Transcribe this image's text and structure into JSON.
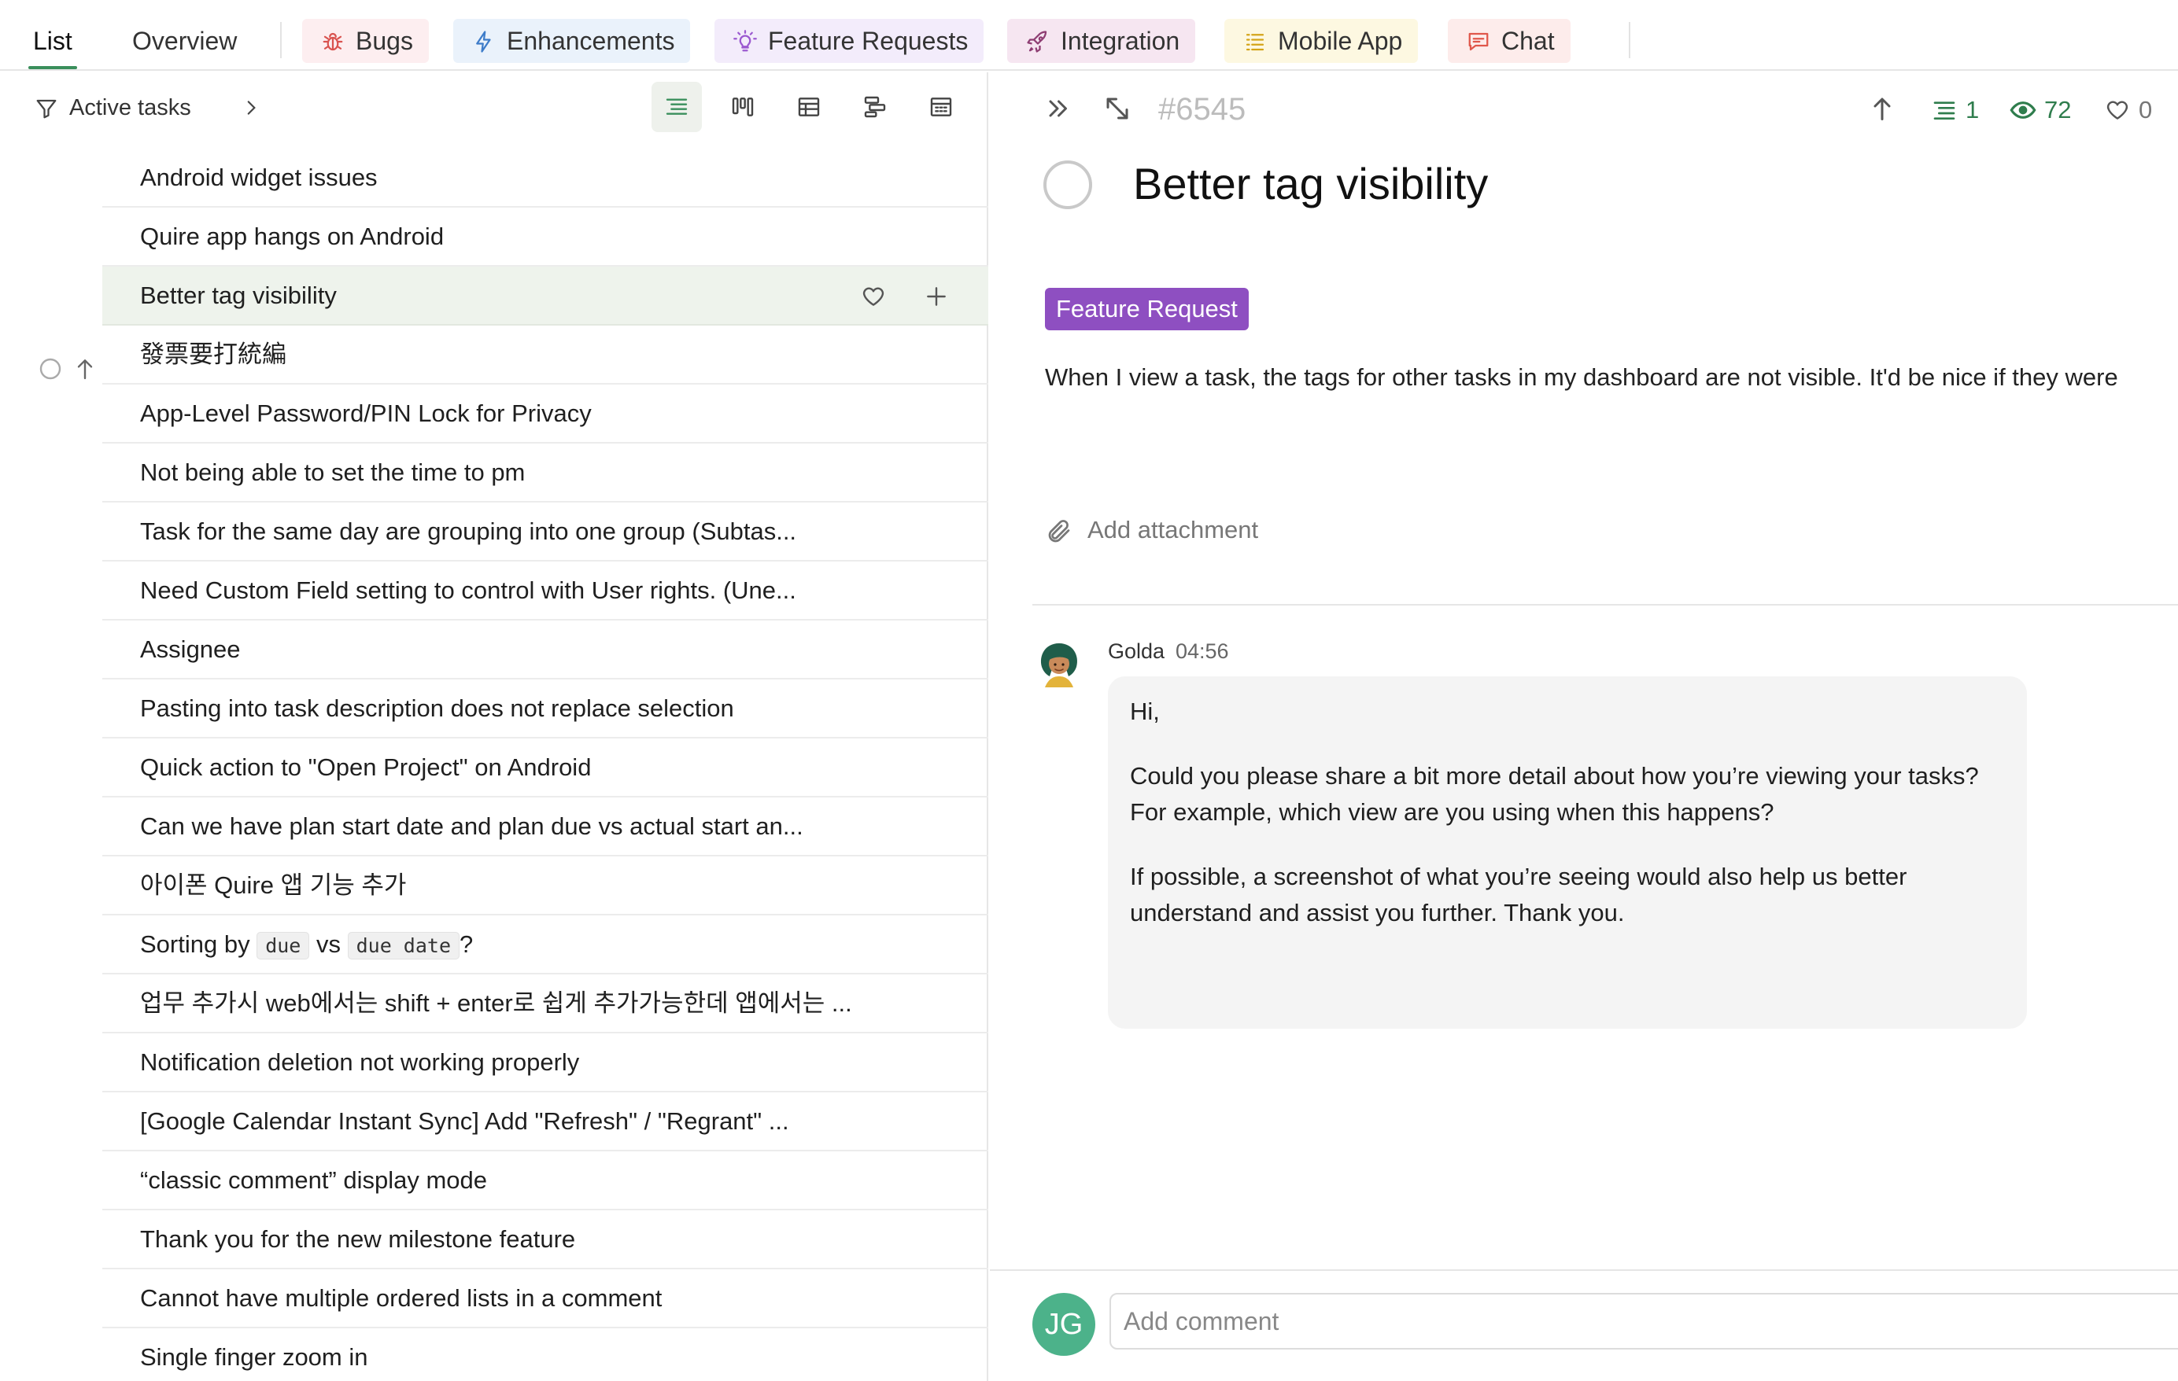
{
  "top_tabs": {
    "list": "List",
    "overview": "Overview",
    "pills": [
      {
        "label": "Bugs",
        "icon": "bug-icon",
        "bg": "#fdeef0",
        "color": "#d9534f"
      },
      {
        "label": "Enhancements",
        "icon": "lightning-icon",
        "bg": "#eaf2fb",
        "color": "#3d7cc9"
      },
      {
        "label": "Feature Requests",
        "icon": "lightbulb-icon",
        "bg": "#f3ecfb",
        "color": "#9b59d0"
      },
      {
        "label": "Integration",
        "icon": "rocket-icon",
        "bg": "#f6e6f1",
        "color": "#8e3d72"
      },
      {
        "label": "Mobile App",
        "icon": "list-icon",
        "bg": "#fdf8e1",
        "color": "#d4a418"
      },
      {
        "label": "Chat",
        "icon": "chat-icon",
        "bg": "#fdeceb",
        "color": "#e0574b"
      }
    ]
  },
  "toolbar": {
    "filter_label": "Active tasks"
  },
  "tasks": [
    {
      "text": "Android widget issues"
    },
    {
      "text": "Quire app hangs on Android"
    },
    {
      "text": "Better tag visibility",
      "selected": true
    },
    {
      "text": "發票要打統編"
    },
    {
      "text": "App-Level Password/PIN Lock for Privacy"
    },
    {
      "text": "Not being able to set the time to pm"
    },
    {
      "text": "Task for the same day are grouping into one group (Subtas..."
    },
    {
      "text": "Need Custom Field setting to control with User rights. (Une..."
    },
    {
      "text": "Assignee"
    },
    {
      "text": "Pasting into task description does not replace selection"
    },
    {
      "text": "Quick action to \"Open Project\" on Android"
    },
    {
      "text": "Can we have plan start date and plan due vs actual start an..."
    },
    {
      "text": "아이폰 Quire 앱 기능 추가"
    },
    {
      "text_parts": [
        "Sorting by ",
        "due",
        " vs ",
        "due date",
        "?"
      ]
    },
    {
      "text": "업무 추가시 web에서는 shift + enter로 쉽게 추가가능한데 앱에서는 ..."
    },
    {
      "text": "Notification deletion not working properly"
    },
    {
      "text": "[Google Calendar Instant Sync] Add \"Refresh\" / \"Regrant\" ..."
    },
    {
      "text": "“classic comment” display mode"
    },
    {
      "text": "Thank you for the new milestone feature"
    },
    {
      "text": "Cannot have multiple ordered lists in a comment"
    },
    {
      "text": "Single finger zoom in"
    }
  ],
  "detail": {
    "task_id": "#6545",
    "subtasks_count": "1",
    "views_count": "72",
    "likes_count": "0",
    "title": "Better tag visibility",
    "tag": "Feature Request",
    "description": "When I view a task, the tags for other tasks in my dashboard are not visible. It'd be nice if they were",
    "add_attachment": "Add attachment",
    "comment": {
      "author": "Golda",
      "time": "04:56",
      "paragraphs": [
        "Hi,",
        "Could you please share a bit more detail about how you’re viewing your tasks? For example, which view are you using when this happens?",
        "If possible, a screenshot of what you’re seeing would also help us better understand and assist you further. Thank you."
      ]
    },
    "composer": {
      "avatar_initials": "JG",
      "placeholder": "Add comment"
    }
  },
  "colors": {
    "accent": "#3a8f5c",
    "tag_purple": "#8e4fc1",
    "metric_green": "#2f7d4d"
  }
}
